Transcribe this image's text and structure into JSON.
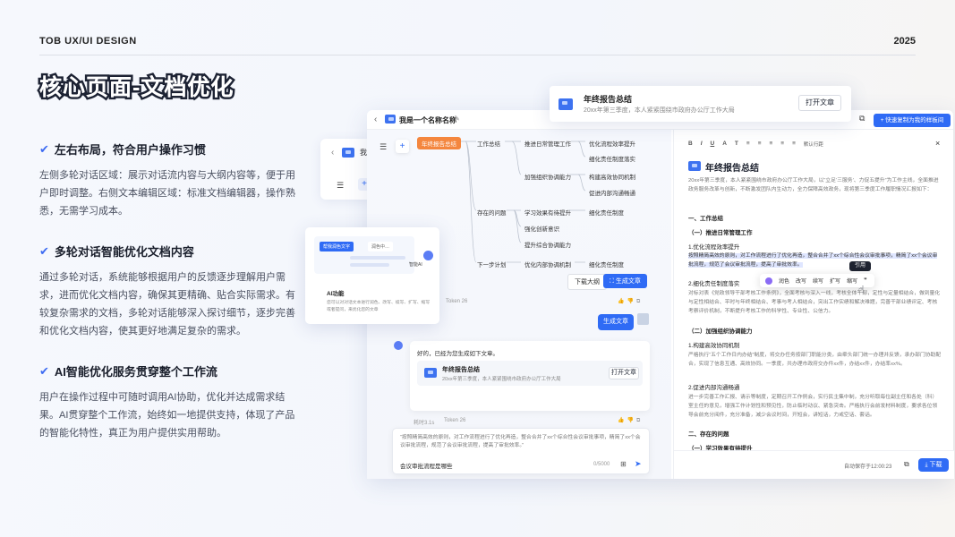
{
  "header": {
    "brand": "TOB  UX/UI DESIGN",
    "year": "2025",
    "title": "核心页面-文档优化"
  },
  "sections": [
    {
      "heading": "左右布局，符合用户操作习惯",
      "body": "左侧多轮对话区域：展示对话流内容与大纲内容等，便于用户即时调整。右侧文本编辑区域：标准文档编辑器，操作熟悉，无需学习成本。"
    },
    {
      "heading": "多轮对话智能优化文档内容",
      "body": "通过多轮对话，系统能够根据用户的反馈逐步理解用户需求，进而优化文档内容，确保其更精确、贴合实际需求。有较复杂需求的文档，多轮对话能够深入探讨细节，逐步完善和优化文档内容，使其更好地满足复杂的需求。"
    },
    {
      "heading": "AI智能优化服务贯穿整个工作流",
      "body": "用户在操作过程中可随时调用AI协助，优化并达成需求结果。AI贯穿整个工作流，始终如一地提供支持，体现了产品的智能化特性，真正为用户提供实用帮助。"
    }
  ],
  "window": {
    "doc_name": "我是一个名称名称",
    "share_label": "+ 快速复制为我的样板间"
  },
  "float_card": {
    "title": "年终报告总结",
    "subtitle": "20xx年第三季度，本人紧紧围绕市政府办公厅工作大局",
    "open": "打开文章"
  },
  "ghost": {
    "back": "‹",
    "menu": "☰",
    "plus": "+",
    "label": "我"
  },
  "ai_card": {
    "tab1": "帮我润色文字",
    "tab2": "润色中…",
    "ai_label": "智能AI",
    "title": "AI功能",
    "desc": "您可以对对话文本进行润色、改写、续写、扩写、缩写或者提问，来优化您的文章"
  },
  "mindmap": {
    "root": "年终报告总结",
    "l1": [
      "工作总结",
      "存在的问题",
      "下一步计划"
    ],
    "l2": [
      "推进日常管理工作",
      "加强组织协调能力",
      "学习效果有待提升",
      "强化创新意识",
      "提升综合协调能力",
      "优化内部协调机制"
    ],
    "l3": [
      "优化流程效率提升",
      "细化责任制度落实",
      "构建高效协同机制",
      "促进内部沟通畅通",
      "细化责任制度",
      "细化责任制度"
    ],
    "btn_outline": "下载大纲",
    "btn_gen": "生成文章"
  },
  "chat": {
    "token1": "Token 26",
    "user_msg": "生成文章",
    "reply": "好的，已经为您生成如下文章。",
    "card_title": "年终报告总结",
    "card_sub": "20xx年第三季度，本人紧紧围绕市政府办公厅工作大局",
    "card_btn": "打开文章",
    "meta2a": "耗时3.1s",
    "meta2b": "Token 26",
    "quote": "“按照精简高效的原则，对工作流程进行了优化再造，整合合并了xx个综合性会议审批事项，精简了xx个会议审批流程，规范了会议审批流程，提高了审批效率。”",
    "input": "会议审批流程是哪些",
    "count": "0/5000"
  },
  "editor": {
    "toolbar": [
      "B",
      "I",
      "U",
      "A",
      "T",
      "≡",
      "≡",
      "≡",
      "≡",
      "≡",
      "默认行距"
    ],
    "doc_title": "年终报告总结",
    "intro": "20xx年第三季度，本人紧紧围绕市政府办公厅工作大局，以“立足‘三服务’、力促五提升”为工作主线，全面推进政务服务改革与创新，不断激发团队内生动力，全力保障高效政务，现将第三季度工作履职情况汇报如下：",
    "h_work": "一、工作总结",
    "h_daily": "（一）推进日常管理工作",
    "h_opt": "1.优化流程效率提升",
    "highlight": "按照精简高效的原则，对工作流程进行了优化再造，整合合并了xx个综合性会议审批事项，精简了xx个会议审批流程，规范了会议审批流程，提高了审批效率。",
    "tooltip": "引用",
    "menu": [
      "润色",
      "改写",
      "续写",
      "扩写",
      "缩写",
      "❞"
    ],
    "h_resp": "2.细化责任制度落实",
    "p_resp": "对标对表《党政领导干部考核工作条例》，全面考核与深入一线，考核全体干部，定性与定量相结合，做到量化与定性相结合、平时与年终相结合、考事与考人相结合，突出工作实绩和解决难题，完善干部业绩评定、考核考察评价机制，不断提升考核工作的科学性、专业性、公信力。",
    "h_coord": "（二）加强组织协调能力",
    "h_sync": "1.构建高效协同机制",
    "p_sync": "严格执行“五个工作日内办结”制度，将交办任务按部门职能分类，由牵头部门统一办理并反馈，承办部门协助配合，实现了信息互通、高效协同。一季度，共办理市政府交办件xx件，办结xx件，办结率xx%。",
    "h_comm": "2.促进内部沟通畅通",
    "p_comm": "进一步完善工作汇报、请示等制度，定期召开工作例会，实行民主集中制，充分听取每位副主任和各处（科）室主任的意见，增强工作计划性和预见性，防止临时动议、紧急突击。严格执行会前发材料制度，要求各位领导会前充分阅件，充分准备，减少会议时间，开短会，讲短话，力戒空话、套话。",
    "h_issue": "二、存在的问题",
    "h_learn": "（一）学习效果有待提升",
    "autosave": "自动保存于12:00:23",
    "download": "下载"
  },
  "colors": {
    "accent": "#2f6bf5",
    "root": "#f4863e",
    "check": "#3d6bf2"
  }
}
